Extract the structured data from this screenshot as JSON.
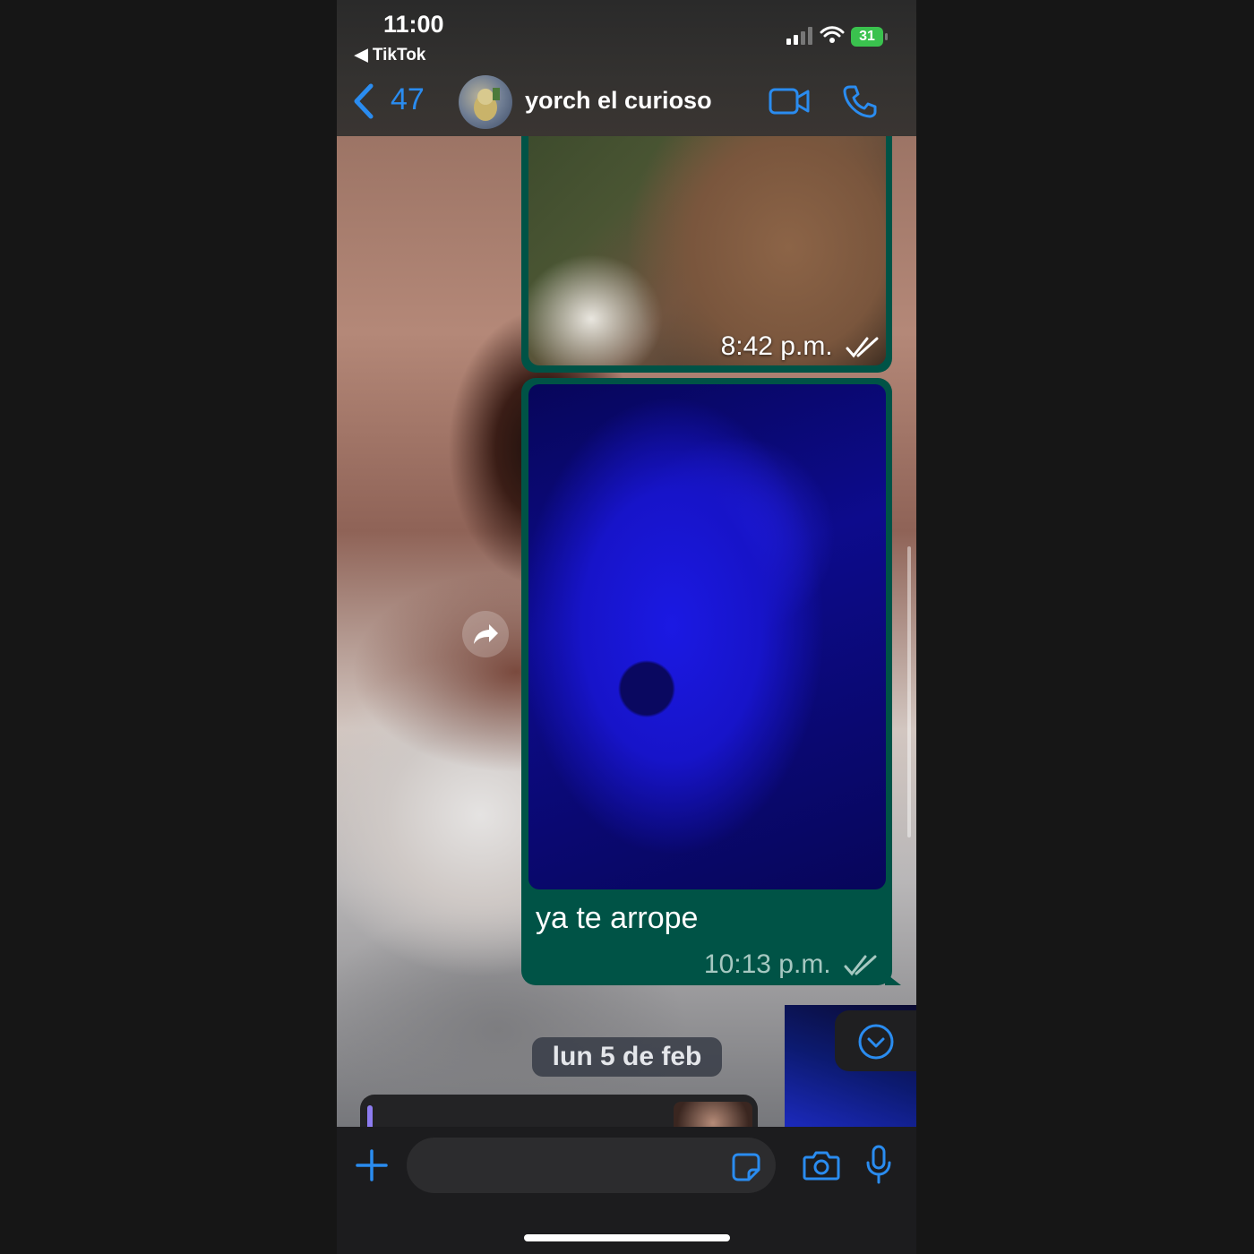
{
  "status_bar": {
    "time": "11:00",
    "back_app": "◀ TikTok",
    "battery": "31"
  },
  "header": {
    "back_count": "47",
    "contact_name": "yorch el curioso"
  },
  "messages": [
    {
      "type": "image",
      "time": "8:42 p.m."
    },
    {
      "type": "image",
      "caption": "ya te arrope",
      "time": "10:13 p.m."
    }
  ],
  "date_separator": "lun 5 de feb",
  "input": {
    "placeholder": ""
  },
  "colors": {
    "accent": "#2a8cf0",
    "bubble_outgoing": "#005346",
    "battery": "#3ac24e"
  },
  "icons": [
    "back-chevron-icon",
    "video-call-icon",
    "phone-icon",
    "forward-icon",
    "chevron-down-icon",
    "plus-icon",
    "sticker-icon",
    "camera-icon",
    "microphone-icon"
  ]
}
